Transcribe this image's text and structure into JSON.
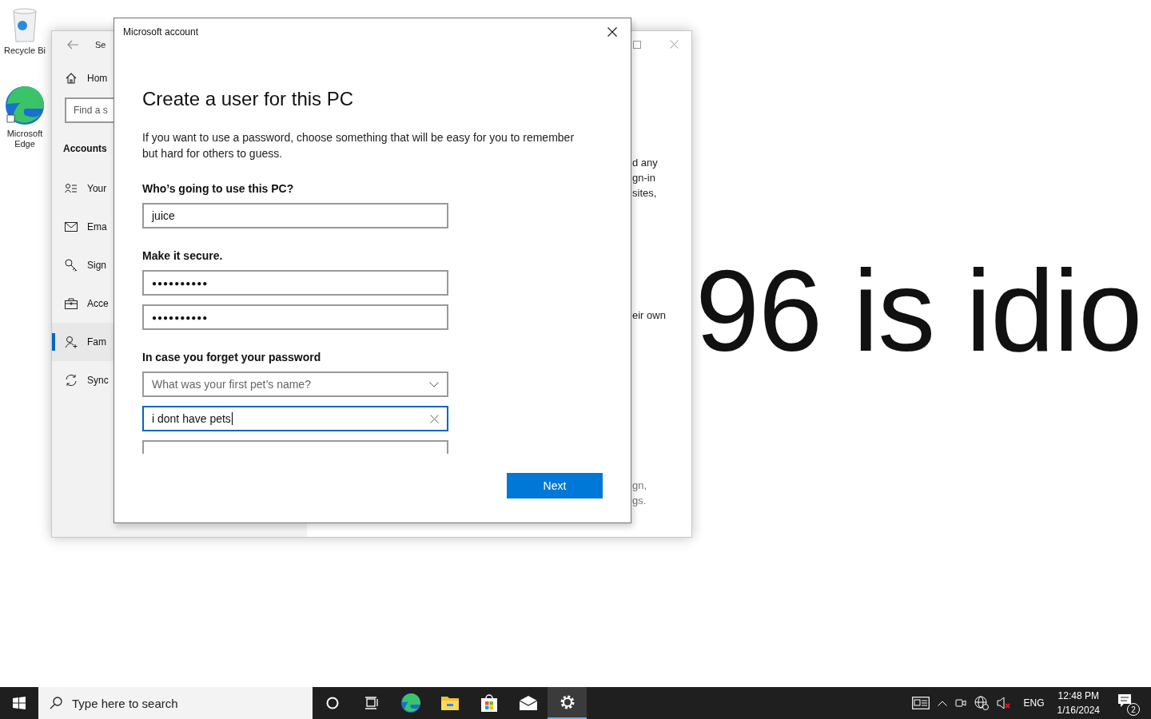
{
  "desktop": {
    "wallpaper_text": "96 is idio",
    "icons": [
      {
        "label": "Recycle Bi"
      },
      {
        "label": "Microsoft Edge"
      }
    ]
  },
  "settings_window": {
    "title": "Se",
    "search": {
      "placeholder": "Find a s"
    },
    "section": "Accounts",
    "home": "Hom",
    "items": [
      {
        "label": "Your",
        "selected": false
      },
      {
        "label": "Ema",
        "selected": false
      },
      {
        "label": "Sign",
        "selected": false
      },
      {
        "label": "Acce",
        "selected": false
      },
      {
        "label": "Fam",
        "selected": true
      },
      {
        "label": "Sync",
        "selected": false
      }
    ],
    "content": [
      {
        "lines": [
          "d any",
          "gn-in",
          "sites,"
        ],
        "dimmed": false
      },
      {
        "lines": [
          "eir own"
        ],
        "dimmed": false
      },
      {
        "lines": [
          "gn,",
          "gs."
        ],
        "dimmed": true
      }
    ]
  },
  "dialog": {
    "title": "Microsoft account",
    "heading": "Create a user for this PC",
    "intro": "If you want to use a password, choose something that will be easy for you to remember but hard for others to guess.",
    "user_label": "Who’s going to use this PC?",
    "user_value": "juice",
    "secure_label": "Make it secure.",
    "password": "●●●●●●●●●●",
    "password_confirm": "●●●●●●●●●●",
    "recovery_label": "In case you forget your password",
    "question": {
      "value": "What was your first pet’s name?"
    },
    "answer": {
      "value": "i dont have pets",
      "focused": true
    },
    "next_button": "Next"
  },
  "taskbar": {
    "search_placeholder": "Type here to search",
    "time": "12:48 PM",
    "date": "1/16/2024",
    "language": "ENG",
    "notification_count": "2"
  }
}
